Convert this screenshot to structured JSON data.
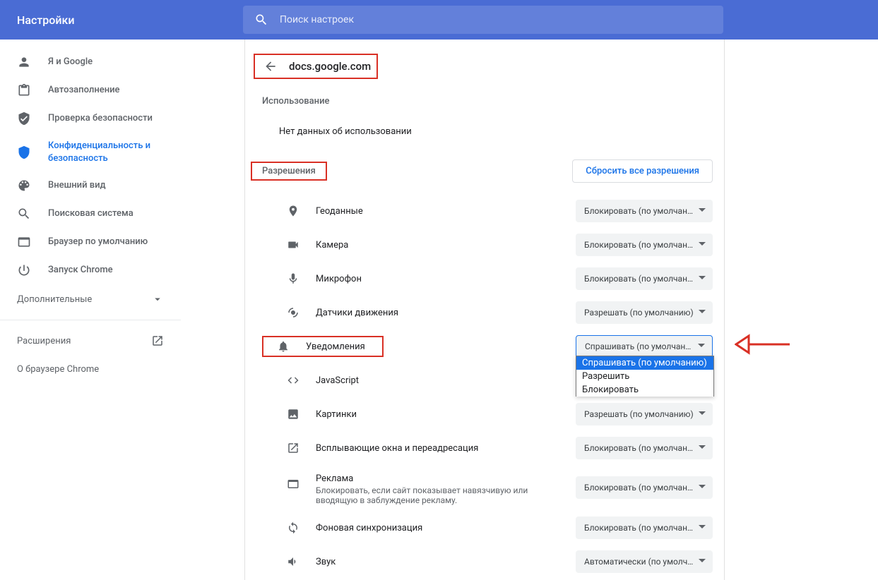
{
  "header": {
    "title": "Настройки",
    "search_placeholder": "Поиск настроек"
  },
  "sidebar": {
    "items": [
      {
        "label": "Я и Google"
      },
      {
        "label": "Автозаполнение"
      },
      {
        "label": "Проверка безопасности"
      },
      {
        "label": "Конфиденциальность и безопасность"
      },
      {
        "label": "Внешний вид"
      },
      {
        "label": "Поисковая система"
      },
      {
        "label": "Браузер по умолчанию"
      },
      {
        "label": "Запуск Chrome"
      }
    ],
    "advanced": "Дополнительные",
    "extensions": "Расширения",
    "about": "О браузере Chrome"
  },
  "content": {
    "site": "docs.google.com",
    "usage_section": "Использование",
    "usage_none": "Нет данных об использовании",
    "permissions_section": "Разрешения",
    "reset_label": "Сбросить все разрешения",
    "permissions": [
      {
        "label": "Геоданные",
        "value": "Блокировать (по умолчанию)"
      },
      {
        "label": "Камера",
        "value": "Блокировать (по умолчанию)"
      },
      {
        "label": "Микрофон",
        "value": "Блокировать (по умолчанию)"
      },
      {
        "label": "Датчики движения",
        "value": "Разрешать (по умолчанию)"
      },
      {
        "label": "Уведомления",
        "value": "Спрашивать (по умолчанию)"
      },
      {
        "label": "JavaScript",
        "value": ""
      },
      {
        "label": "Картинки",
        "value": "Разрешать (по умолчанию)"
      },
      {
        "label": "Всплывающие окна и переадресация",
        "value": "Блокировать (по умолчанию)"
      },
      {
        "label": "Реклама",
        "sub": "Блокировать, если сайт показывает навязчивую или вводящую в заблуждение рекламу.",
        "value": "Блокировать (по умолчанию)"
      },
      {
        "label": "Фоновая синхронизация",
        "value": "Блокировать (по умолчанию)"
      },
      {
        "label": "Звук",
        "value": "Автоматически (по умолчанию)"
      }
    ],
    "dropdown_options": [
      "Спрашивать (по умолчанию)",
      "Разрешить",
      "Блокировать"
    ]
  }
}
